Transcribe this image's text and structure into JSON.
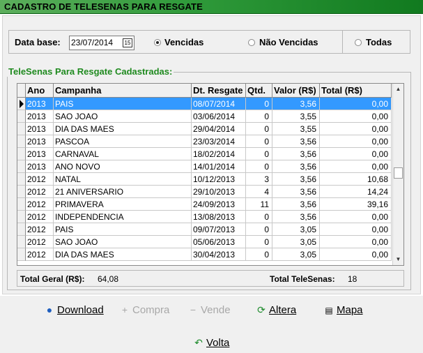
{
  "title": "CADASTRO DE TELESENAS PARA RESGATE",
  "filter": {
    "date_label": "Data base:",
    "date_value": "23/07/2014",
    "calendar_icon": "calendar-icon",
    "options": [
      {
        "label": "Vencidas",
        "selected": true
      },
      {
        "label": "Não Vencidas",
        "selected": false
      },
      {
        "label": "Todas",
        "selected": false
      }
    ]
  },
  "group": {
    "title": "TeleSenas Para Resgate Cadastradas:"
  },
  "grid": {
    "columns": [
      "Ano",
      "Campanha",
      "Dt. Resgate",
      "Qtd.",
      "Valor (R$)",
      "Total (R$)"
    ],
    "rows": [
      [
        "2013",
        "PAIS",
        "08/07/2014",
        "0",
        "3,56",
        "0,00"
      ],
      [
        "2013",
        "SAO JOAO",
        "03/06/2014",
        "0",
        "3,55",
        "0,00"
      ],
      [
        "2013",
        "DIA DAS MAES",
        "29/04/2014",
        "0",
        "3,55",
        "0,00"
      ],
      [
        "2013",
        "PASCOA",
        "23/03/2014",
        "0",
        "3,56",
        "0,00"
      ],
      [
        "2013",
        "CARNAVAL",
        "18/02/2014",
        "0",
        "3,56",
        "0,00"
      ],
      [
        "2013",
        "ANO NOVO",
        "14/01/2014",
        "0",
        "3,56",
        "0,00"
      ],
      [
        "2012",
        "NATAL",
        "10/12/2013",
        "3",
        "3,56",
        "10,68"
      ],
      [
        "2012",
        "21 ANIVERSARIO",
        "29/10/2013",
        "4",
        "3,56",
        "14,24"
      ],
      [
        "2012",
        "PRIMAVERA",
        "24/09/2013",
        "11",
        "3,56",
        "39,16"
      ],
      [
        "2012",
        "INDEPENDENCIA",
        "13/08/2013",
        "0",
        "3,56",
        "0,00"
      ],
      [
        "2012",
        "PAIS",
        "09/07/2013",
        "0",
        "3,05",
        "0,00"
      ],
      [
        "2012",
        "SAO JOAO",
        "05/06/2013",
        "0",
        "3,05",
        "0,00"
      ],
      [
        "2012",
        "DIA DAS MAES",
        "30/04/2013",
        "0",
        "3,05",
        "0,00"
      ]
    ],
    "selected_row": 0
  },
  "totals": {
    "geral_label": "Total Geral (R$):",
    "geral_value": "64,08",
    "telesenas_label": "Total TeleSenas:",
    "telesenas_value": "18"
  },
  "actions": {
    "download": "Download",
    "compra": "Compra",
    "vende": "Vende",
    "altera": "Altera",
    "mapa": "Mapa",
    "volta": "Volta"
  }
}
